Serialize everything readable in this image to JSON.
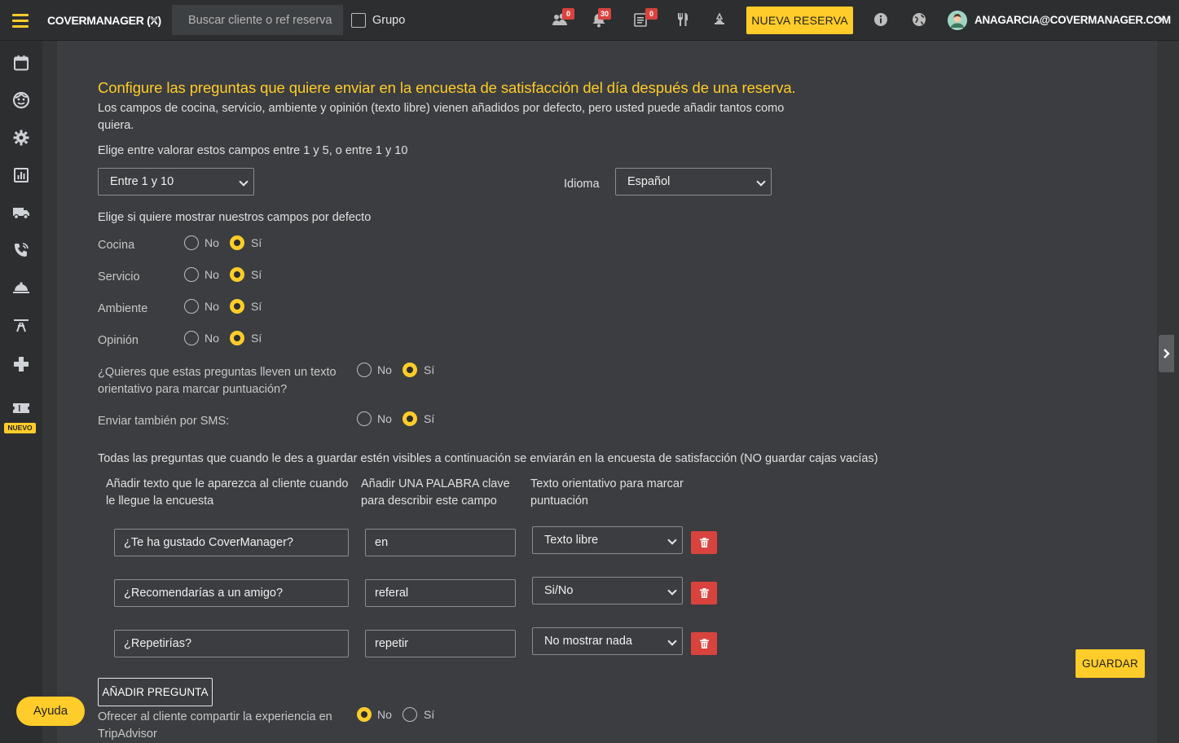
{
  "topbar": {
    "brand": "COVERMANAGER (X)",
    "search_placeholder": "Buscar cliente o ref reserva",
    "grupo_label": "Grupo",
    "badges": {
      "waitlist": "0",
      "notifications": "30",
      "reservations": "0"
    },
    "nueva_reserva_label": "NUEVA RESERVA",
    "user_email": "ANAGARCIA@COVERMANAGER.COM"
  },
  "sidebar": {
    "nuevo_tag": "NUEVO"
  },
  "form": {
    "title": "Configure las preguntas que quiere enviar en la encuesta de satisfacción del día después de una reserva.",
    "description_line1": "Los campos de cocina, servicio, ambiente y opinión (texto libre) vienen añadidos por defecto, pero usted puede añadir tantos como",
    "description_line2": "quiera.",
    "rating_prompt": "Elige entre valorar estos campos entre 1 y 5, o entre 1 y 10",
    "rating_select": "Entre 1 y 10",
    "idioma_label": "Idioma",
    "idioma_select": "Español",
    "default_fields_prompt": "Elige si quiere mostrar nuestros campos por defecto",
    "no_label": "No",
    "si_label": "Sí",
    "fields": [
      {
        "label": "Cocina",
        "selected": "si"
      },
      {
        "label": "Servicio",
        "selected": "si"
      },
      {
        "label": "Ambiente",
        "selected": "si"
      },
      {
        "label": "Opinión",
        "selected": "si"
      }
    ],
    "orientative_line1": "¿Quieres que estas preguntas lleven un texto",
    "orientative_line2": "orientativo para marcar puntuación?",
    "sms_label": "Enviar también por SMS:",
    "questions_note": "Todas las preguntas que cuando le des a guardar estén visibles a continuación se enviarán en la encuesta de satisfacción (NO guardar cajas vacías)",
    "col1_line1": "Añadir texto que le aparezca al cliente cuando",
    "col1_line2": "le llegue la encuesta",
    "col2_line1": "Añadir UNA PALABRA clave",
    "col2_line2": "para describir este campo",
    "col3_line1": "Texto orientativo para marcar",
    "col3_line2": "puntuación",
    "questions": [
      {
        "text": "¿Te ha gustado CoverManager?",
        "keyword": "en",
        "hint": "Texto libre"
      },
      {
        "text": "¿Recomendarías a un amigo?",
        "keyword": "referal",
        "hint": "Si/No"
      },
      {
        "text": "¿Repetirías?",
        "keyword": "repetir",
        "hint": "No mostrar nada"
      }
    ],
    "guardar_label": "GUARDAR",
    "anadir_label": "AÑADIR PREGUNTA",
    "tripadvisor_line1": "Ofrecer al cliente compartir la experiencia en",
    "tripadvisor_line2": "TripAdvisor"
  },
  "ayuda_label": "Ayuda",
  "colors": {
    "accent": "#ffcc29",
    "danger": "#d9433e",
    "background": "#3b3d40",
    "bar": "#2c2e30"
  }
}
